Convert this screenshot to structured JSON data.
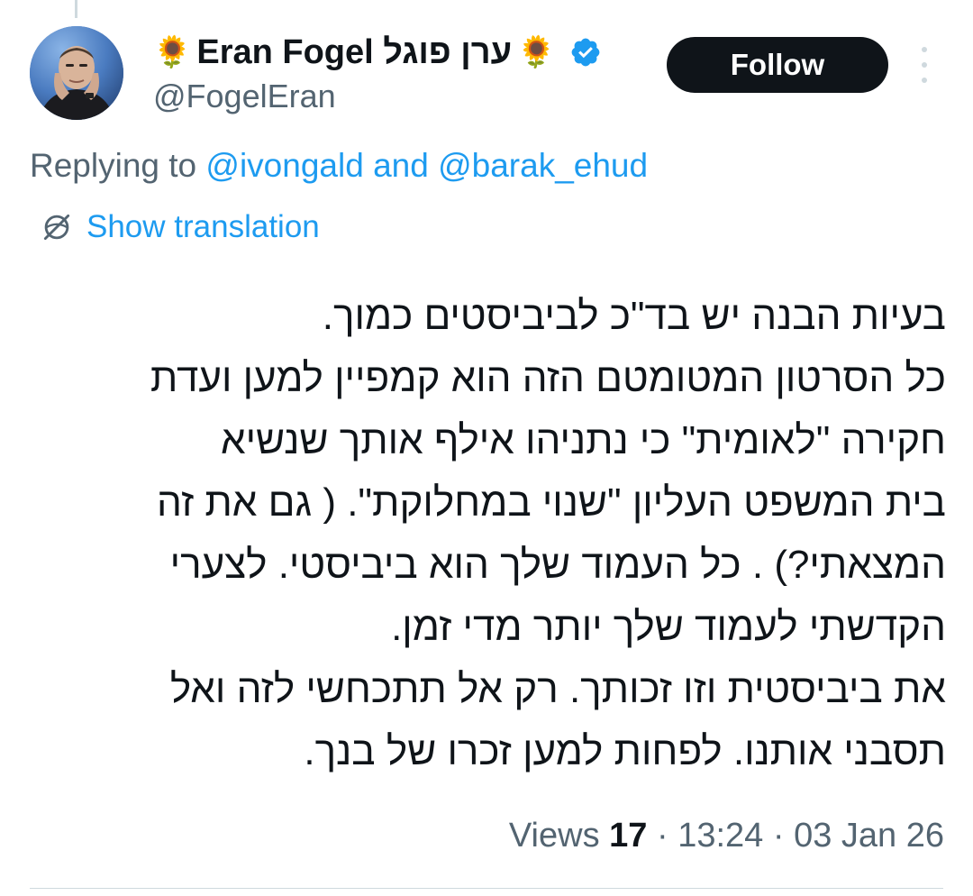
{
  "author": {
    "display_name": "Eran Fogel ערן פוגל",
    "emoji_left": "🌻",
    "emoji_right": "🌻",
    "handle": "@FogelEran",
    "verified": true
  },
  "follow_button": {
    "label": "Follow"
  },
  "reply_context": {
    "prefix": "Replying to",
    "mention_1": "@ivongald",
    "joiner": "and",
    "mention_2": "@barak_ehud"
  },
  "translation": {
    "label": "Show translation"
  },
  "tweet": {
    "lines": [
      "בעיות הבנה יש בד\"כ לביביסטים כמוך.",
      "כל הסרטון המטומטם הזה הוא קמפיין למען ועדת",
      "חקירה \"לאומית\" כי נתניהו אילף אותך שנשיא",
      "בית המשפט העליון \"שנוי במחלוקת\". ( גם את זה",
      "המצאתי?) . כל העמוד שלך הוא ביביסטי. לצערי",
      "הקדשתי לעמוד שלך יותר מדי זמן.",
      "את ביביסטית וזו זכותך. רק אל תתכחשי לזה ואל",
      "תסבני אותנו. לפחות למען זכרו של בנך."
    ]
  },
  "meta": {
    "views_label": "Views",
    "views_count": "17",
    "separator": "·",
    "time": "13:24",
    "date": "03 Jan 26"
  },
  "colors": {
    "link": "#1d9bf0",
    "secondary_text": "#536471",
    "primary_text": "#0f1419",
    "follow_bg": "#0f1419"
  },
  "icons": {
    "verified": "verified-badge-icon",
    "translate": "translate-globe-icon",
    "more": "more-vertical-icon"
  }
}
